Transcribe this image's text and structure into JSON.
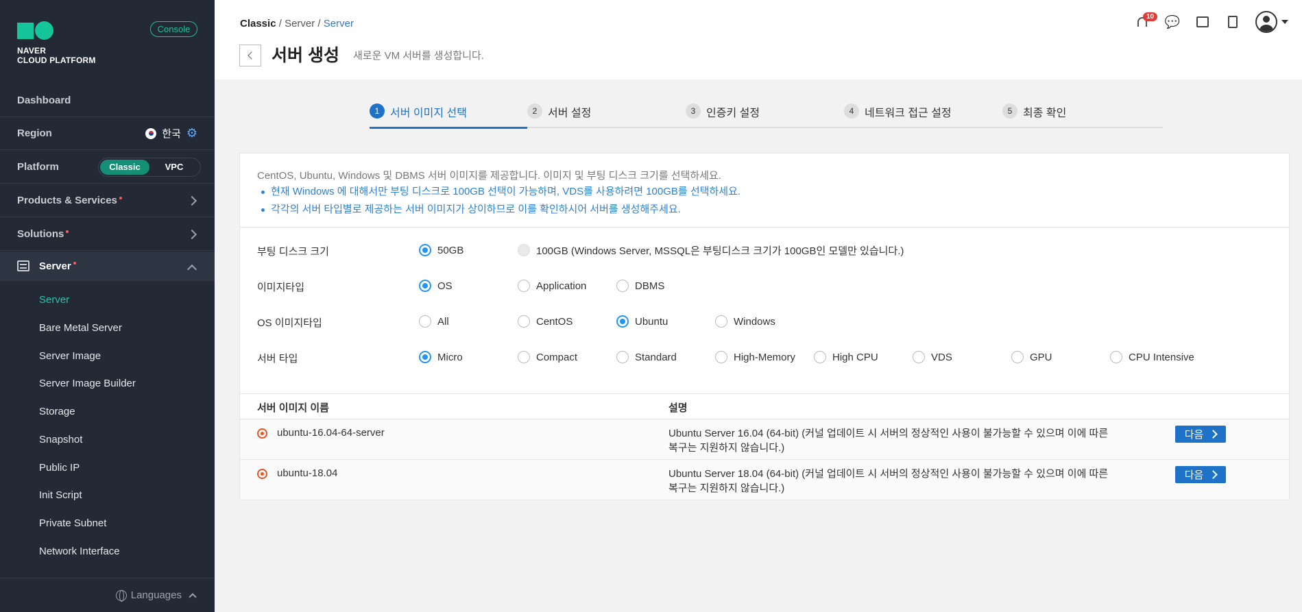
{
  "sidebar": {
    "brand_line1": "NAVER",
    "brand_line2": "CLOUD PLATFORM",
    "console_label": "Console",
    "dashboard": "Dashboard",
    "region_label": "Region",
    "region_value": "한국",
    "platform_label": "Platform",
    "platform_options": [
      "Classic",
      "VPC"
    ],
    "platform_selected": "Classic",
    "products": "Products & Services",
    "solutions": "Solutions",
    "server": "Server",
    "sub_items": [
      "Server",
      "Bare Metal Server",
      "Server Image",
      "Server Image Builder",
      "Storage",
      "Snapshot",
      "Public IP",
      "Init Script",
      "Private Subnet",
      "Network Interface"
    ],
    "languages": "Languages"
  },
  "header": {
    "breadcrumb": [
      "Classic",
      "Server",
      "Server"
    ],
    "title": "서버 생성",
    "description": "새로운 VM 서버를 생성합니다.",
    "notification_count": "10"
  },
  "steps": [
    {
      "num": "1",
      "label": "서버 이미지 선택"
    },
    {
      "num": "2",
      "label": "서버 설정"
    },
    {
      "num": "3",
      "label": "인증키 설정"
    },
    {
      "num": "4",
      "label": "네트워크 접근 설정"
    },
    {
      "num": "5",
      "label": "최종 확인"
    }
  ],
  "notice": {
    "intro": "CentOS, Ubuntu, Windows 및 DBMS 서버 이미지를 제공합니다. 이미지 및 부팅 디스크 크기를 선택하세요.",
    "bullets": [
      "현재 Windows 에 대해서만 부팅 디스크로 100GB 선택이 가능하며, VDS를 사용하려면 100GB를 선택하세요.",
      "각각의 서버 타입별로 제공하는 서버 이미지가 상이하므로 이를 확인하시어 서버를 생성해주세요."
    ]
  },
  "options": {
    "boot_disk": {
      "label": "부팅 디스크 크기",
      "choices": [
        "50GB",
        "100GB (Windows Server, MSSQL은 부팅디스크 크기가 100GB인 모델만 있습니다.)"
      ],
      "selected": "50GB"
    },
    "image_type": {
      "label": "이미지타입",
      "choices": [
        "OS",
        "Application",
        "DBMS"
      ],
      "selected": "OS"
    },
    "os_image_type": {
      "label": "OS 이미지타입",
      "choices": [
        "All",
        "CentOS",
        "Ubuntu",
        "Windows"
      ],
      "selected": "Ubuntu"
    },
    "server_type": {
      "label": "서버 타입",
      "choices": [
        "Micro",
        "Compact",
        "Standard",
        "High-Memory",
        "High CPU",
        "VDS",
        "GPU",
        "CPU Intensive"
      ],
      "selected": "Micro"
    }
  },
  "table": {
    "columns": [
      "서버 이미지 이름",
      "설명"
    ],
    "rows": [
      {
        "name": "ubuntu-16.04-64-server",
        "desc": "Ubuntu Server 16.04 (64-bit) (커널 업데이트 시 서버의 정상적인 사용이 불가능할 수 있으며 이에 따른 복구는 지원하지 않습니다.)",
        "action": "다음"
      },
      {
        "name": "ubuntu-18.04",
        "desc": "Ubuntu Server 18.04 (64-bit) (커널 업데이트 시 서버의 정상적인 사용이 불가능할 수 있으며 이에 따른 복구는 지원하지 않습니다.)",
        "action": "다음"
      }
    ]
  },
  "colors": {
    "accent": "#1e73c8",
    "brand": "#15c69a",
    "sidebar_bg": "#232a35",
    "active_sub": "#22c8a8"
  }
}
